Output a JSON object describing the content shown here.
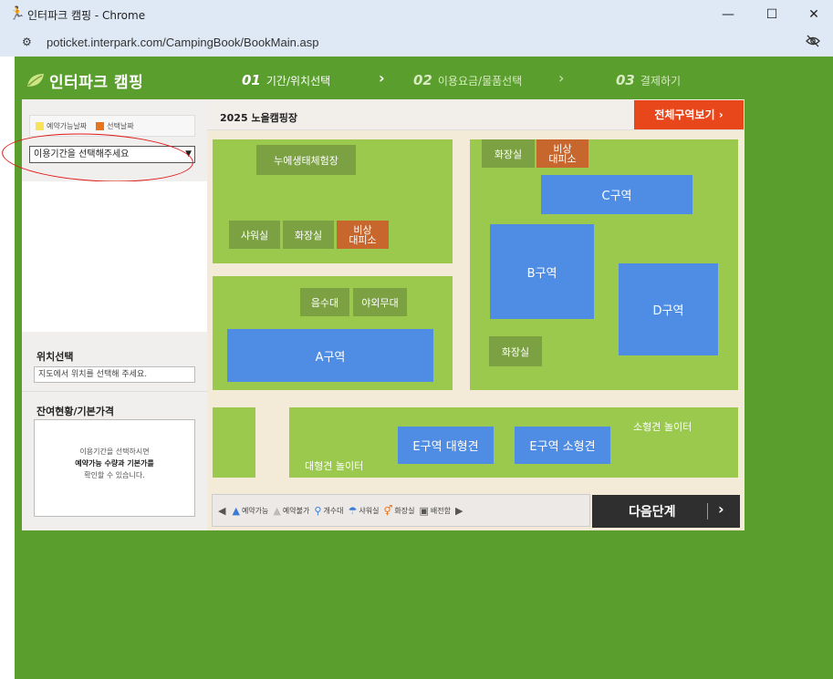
{
  "browser": {
    "title": "인터파크 캠핑 - Chrome",
    "url": "poticket.interpark.com/CampingBook/BookMain.asp",
    "minimize": "—",
    "maximize": "☐",
    "close": "✕"
  },
  "header": {
    "logo_text": "인터파크 캠핑",
    "steps": [
      {
        "num": "01",
        "label": "기간/위치선택"
      },
      {
        "num": "02",
        "label": "이용요금/물품선택"
      },
      {
        "num": "03",
        "label": "결제하기"
      }
    ]
  },
  "sidebar": {
    "legend": {
      "available": "예약가능날짜",
      "selected": "선택날짜"
    },
    "period_select": "이용기간을 선택해주세요",
    "location_title": "위치선택",
    "location_placeholder": "지도에서 위치를 선택해 주세요.",
    "status_title": "잔여현황/기본가격",
    "info_line1": "이용기간을 선택하시면",
    "info_line2": "예약가능 수량과 기본가를",
    "info_line3": "확인할 수 있습니다."
  },
  "map": {
    "title": "2025 노을캠핑장",
    "all_zones_button": "전체구역보기 ›",
    "facilities": {
      "eco": "누에생태체험장",
      "shower": "샤워실",
      "restroom": "화장실",
      "emergency_line1": "비상",
      "emergency_line2": "대피소",
      "water": "음수대",
      "outdoor_table": "야외무대"
    },
    "zones": {
      "a": "A구역",
      "b": "B구역",
      "c": "C구역",
      "d": "D구역",
      "e_large": "E구역 대형견",
      "e_small": "E구역 소형견"
    },
    "labels": {
      "small_dog": "소형견 놀이터",
      "large_dog": "대형견 놀이터"
    }
  },
  "bottom_legend": {
    "available": "예약가능",
    "unavailable": "예약불가",
    "sink": "개수대",
    "shower": "샤워실",
    "restroom": "화장실",
    "power": "배전함"
  },
  "next_button": "다음단계",
  "colors": {
    "page_bg": "#5a9e2e",
    "grass": "#9ac94e",
    "zone_blue": "#4f8de4",
    "accent_orange": "#e8461b",
    "annotation_red": "#e01818"
  }
}
